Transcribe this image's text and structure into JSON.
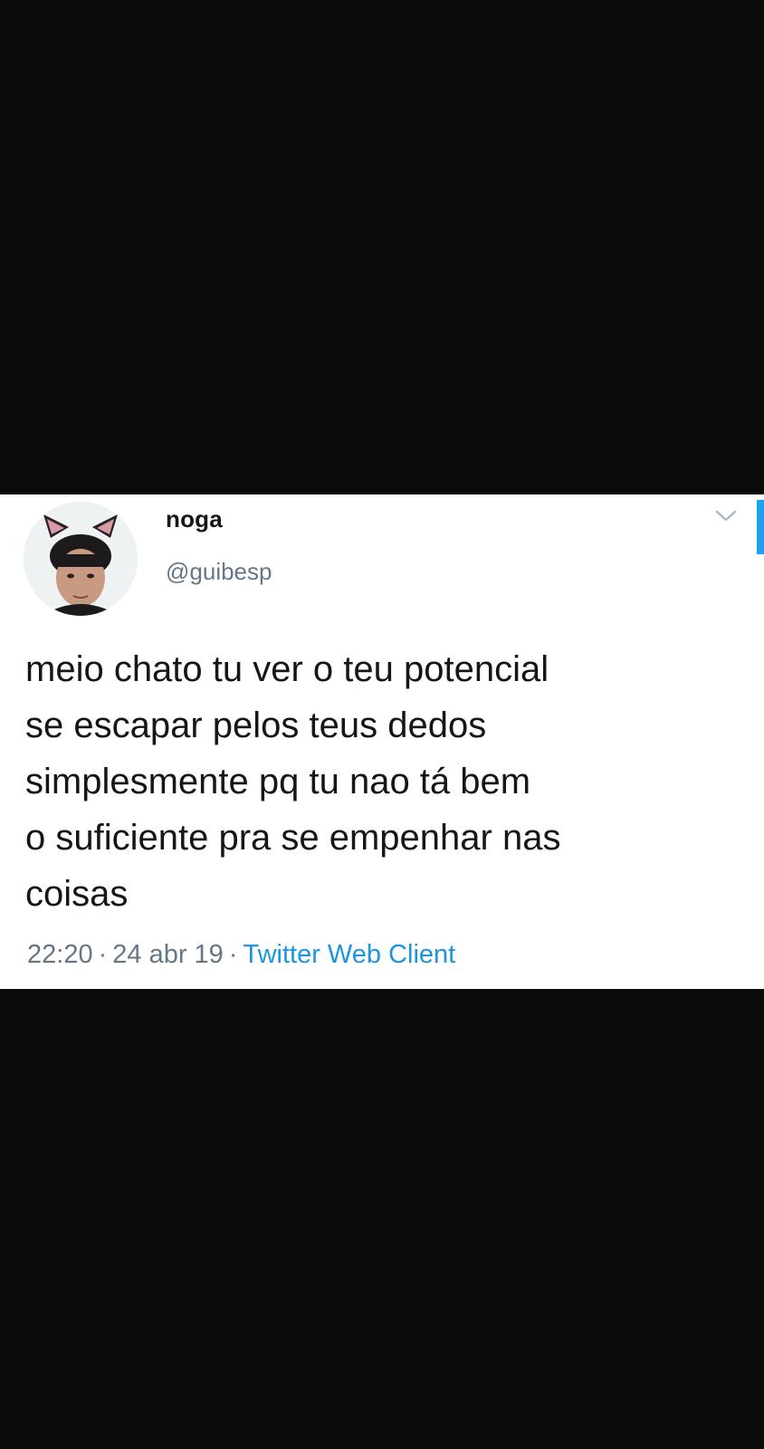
{
  "tweet": {
    "author_name": "noga",
    "author_handle": "@guibesp",
    "text_lines": [
      "meio chato tu ver o teu potencial",
      "se escapar pelos teus dedos",
      "simplesmente pq tu nao tá bem",
      "o suficiente pra se empenhar nas",
      "coisas"
    ],
    "time": "22:20",
    "date": "24 abr 19",
    "separator": "·",
    "source": "Twitter Web Client"
  },
  "icons": {
    "caret": "chevron-down-icon",
    "avatar": "avatar-image"
  },
  "colors": {
    "background": "#0b0b0c",
    "card": "#ffffff",
    "text": "#14171a",
    "secondary": "#657786",
    "link": "#1b95e0",
    "accent": "#1da1f2"
  }
}
